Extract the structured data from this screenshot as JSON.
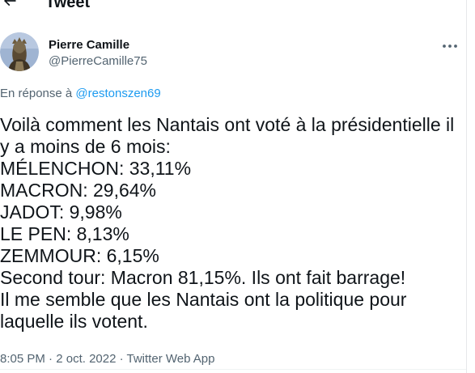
{
  "header": {
    "title": "Tweet",
    "back_icon": "arrow-left-icon"
  },
  "author": {
    "name": "Pierre Camille",
    "handle": "@PierreCamille75",
    "avatar_icon": "statue-avatar-icon"
  },
  "reply": {
    "prefix": "En réponse à ",
    "mention": "@restonszen69"
  },
  "tweet": {
    "lines": [
      "Voilà comment les Nantais ont voté à la présidentielle il",
      "y a moins de 6 mois:",
      "MÉLENCHON: 33,11%",
      "MACRON: 29,64%",
      "JADOT: 9,98%",
      "LE PEN: 8,13%",
      "ZEMMOUR: 6,15%",
      "Second tour: Macron 81,15%. Ils ont fait barrage!",
      "Il me semble que les Nantais ont la politique pour",
      "laquelle ils votent."
    ]
  },
  "meta": {
    "time": "8:05 PM",
    "separator1": " · ",
    "date": "2 oct. 2022",
    "separator2": " · ",
    "source": "Twitter Web App"
  },
  "colors": {
    "text": "#0f1419",
    "secondary": "#536471",
    "accent": "#1d9bf0"
  }
}
